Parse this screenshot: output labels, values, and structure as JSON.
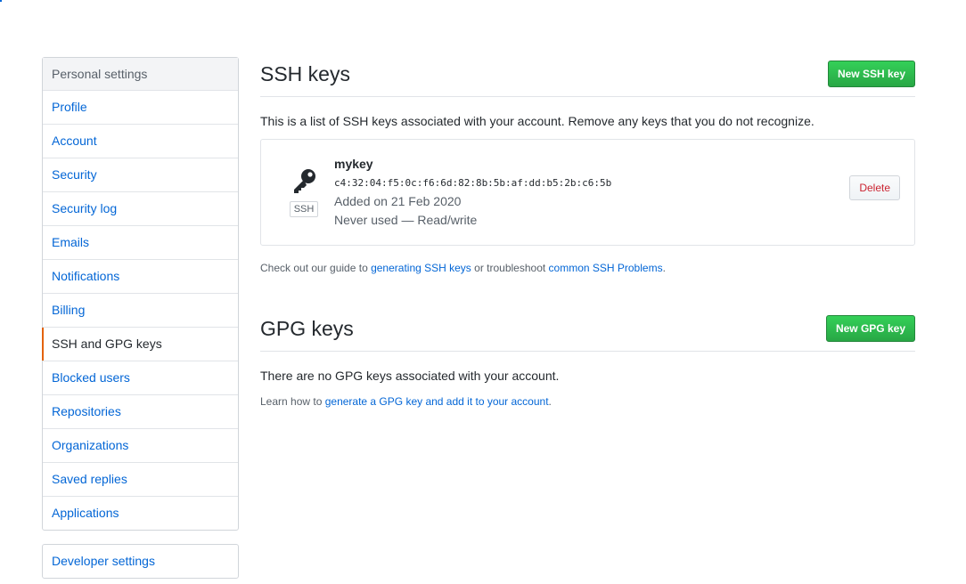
{
  "sidebar": {
    "heading": "Personal settings",
    "items": [
      {
        "label": "Profile"
      },
      {
        "label": "Account"
      },
      {
        "label": "Security"
      },
      {
        "label": "Security log"
      },
      {
        "label": "Emails"
      },
      {
        "label": "Notifications"
      },
      {
        "label": "Billing"
      },
      {
        "label": "SSH and GPG keys",
        "selected": true
      },
      {
        "label": "Blocked users"
      },
      {
        "label": "Repositories"
      },
      {
        "label": "Organizations"
      },
      {
        "label": "Saved replies"
      },
      {
        "label": "Applications"
      }
    ],
    "developer_settings": "Developer settings"
  },
  "ssh": {
    "title": "SSH keys",
    "new_button": "New SSH key",
    "description": "This is a list of SSH keys associated with your account. Remove any keys that you do not recognize.",
    "key": {
      "type_label": "SSH",
      "name": "mykey",
      "fingerprint": "c4:32:04:f5:0c:f6:6d:82:8b:5b:af:dd:b5:2b:c6:5b",
      "added": "Added on 21 Feb 2020",
      "usage": "Never used — Read/write",
      "delete_label": "Delete"
    },
    "guide": {
      "prefix": "Check out our guide to ",
      "link1": "generating SSH keys",
      "middle": " or troubleshoot ",
      "link2": "common SSH Problems",
      "suffix": "."
    }
  },
  "gpg": {
    "title": "GPG keys",
    "new_button": "New GPG key",
    "empty_text": "There are no GPG keys associated with your account.",
    "learn": {
      "prefix": "Learn how to ",
      "link": "generate a GPG key and add it to your account",
      "suffix": "."
    }
  },
  "colors": {
    "link": "#0366d6",
    "accent_selected": "#e36209",
    "primary_button": "#28a745",
    "danger": "#cb2431"
  },
  "icons": {
    "key": "key-icon"
  }
}
